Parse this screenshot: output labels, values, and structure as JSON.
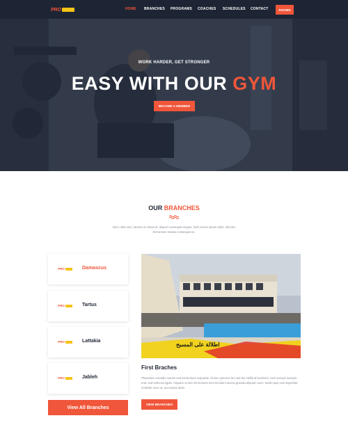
{
  "nav": {
    "logo_text": "PRO",
    "items": [
      {
        "label": "HOME"
      },
      {
        "label": "BRANCHES"
      },
      {
        "label": "PROGRAMS"
      },
      {
        "label": "COACHES"
      },
      {
        "label": "SCHEDULES"
      },
      {
        "label": "CONTACT"
      }
    ],
    "cta_label": "ROOMS"
  },
  "hero": {
    "subtitle": "WORK HARDER, GET STRONGER",
    "title_main": "EASY WITH OUR ",
    "title_accent": "GYM",
    "button_label": "BECOME A MEMBER"
  },
  "branches": {
    "title_main": "OUR ",
    "title_accent": "BRANCHES",
    "description": "Nunc ubis sem, laoreet ut metus id, aliquet consequat magna. Sed viverra ipsum dolor, ultricies fermentum massa consequat eu.",
    "cards": [
      {
        "logo_text": "PRO",
        "name": "Damascus"
      },
      {
        "logo_text": "PRO",
        "name": "Tartus"
      },
      {
        "logo_text": "PRO",
        "name": "Lattakia"
      },
      {
        "logo_text": "PRO",
        "name": "Jableh"
      }
    ],
    "all_button_label": "View All Branches",
    "photo_caption": "اطلالة على المسبح",
    "detail_title": "First Braches",
    "detail_desc": "Phasellus convallis mauris sed elementum vulputate. Donec posuere leo sed dui eleifend hendrerit. Sed suscipit suscipit erat, sed vehicula ligula. Aliquam ut sem fermentum sem tincidunt lacinia gravida aliquam nunc. Morbi quis erat imperdiet, molestie nunc ut, accumsan diam.",
    "detail_button_label": "VIEW BRANCHES"
  },
  "colors": {
    "accent": "#f0563a",
    "nav_bg": "#1d2433",
    "logo_badge": "#f4c416"
  }
}
